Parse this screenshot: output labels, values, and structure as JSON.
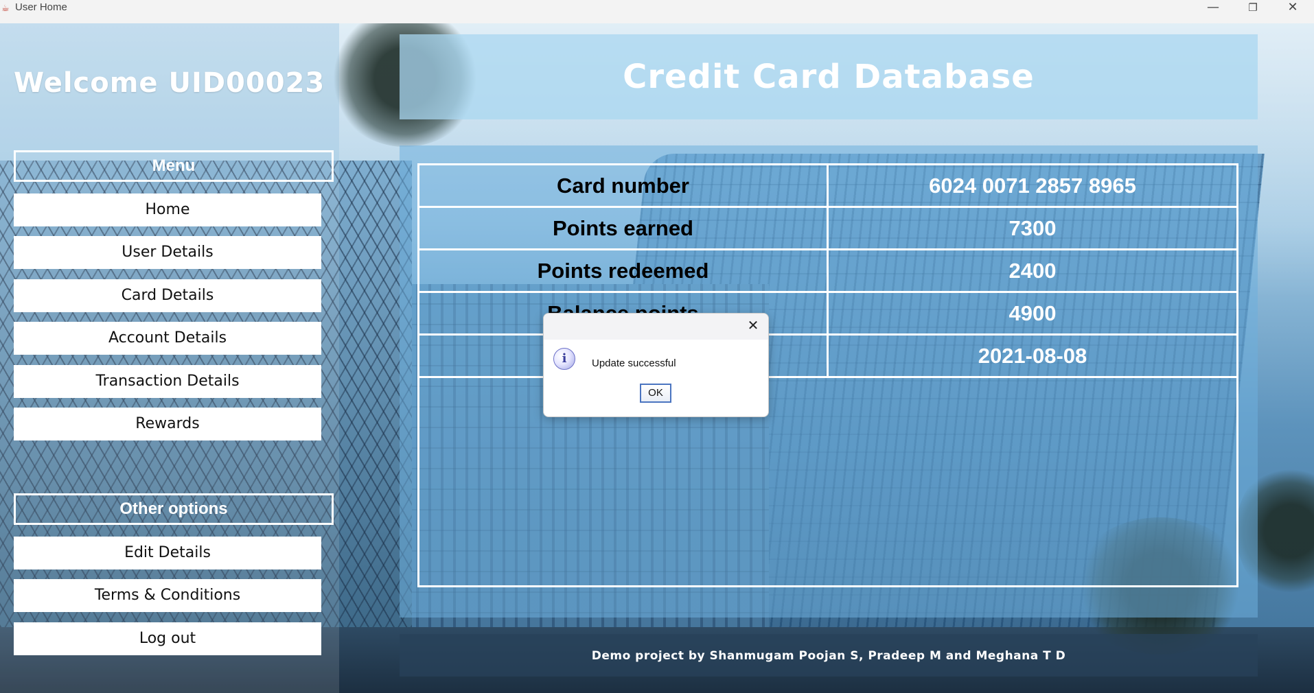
{
  "window": {
    "title": "User Home",
    "app_icon": "java-cup-icon",
    "minimize_glyph": "—",
    "restore_glyph": "❐",
    "close_glyph": "✕"
  },
  "sidebar": {
    "welcome": "Welcome UID00023",
    "menu_header": "Menu",
    "menu_items": [
      {
        "label": "Home"
      },
      {
        "label": "User Details"
      },
      {
        "label": "Card Details"
      },
      {
        "label": "Account Details"
      },
      {
        "label": "Transaction Details"
      },
      {
        "label": "Rewards"
      }
    ],
    "other_header": "Other options",
    "other_items": [
      {
        "label": "Edit Details"
      },
      {
        "label": "Terms & Conditions"
      },
      {
        "label": "Log out"
      }
    ]
  },
  "main": {
    "title": "Credit Card Database",
    "rows": [
      {
        "label": "Card number",
        "value": "6024 0071 2857 8965"
      },
      {
        "label": "Points earned",
        "value": "7300"
      },
      {
        "label": "Points redeemed",
        "value": "2400"
      },
      {
        "label": "Balance points",
        "value": "4900"
      },
      {
        "label": "",
        "value": "2021-08-08"
      }
    ],
    "footer": "Demo project by Shanmugam Poojan S, Pradeep M and Meghana T D"
  },
  "dialog": {
    "message": "Update successful",
    "ok_label": "OK",
    "close_glyph": "✕",
    "icon_glyph": "i",
    "icon": "information-icon"
  }
}
